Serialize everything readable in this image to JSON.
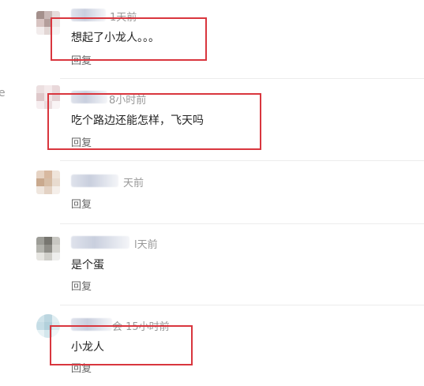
{
  "edge_text": "e",
  "reply_label": "回复",
  "highlight_color": "#d9363e",
  "comments": [
    {
      "time": "1天前",
      "text": "想起了小龙人。。。"
    },
    {
      "time": "8小时前",
      "text": "吃个路边还能怎样，飞天吗"
    },
    {
      "time": "天前",
      "text": ""
    },
    {
      "time": "l天前",
      "text": "是个蛋"
    },
    {
      "time": "会 15小时前",
      "text": "小龙人"
    }
  ]
}
